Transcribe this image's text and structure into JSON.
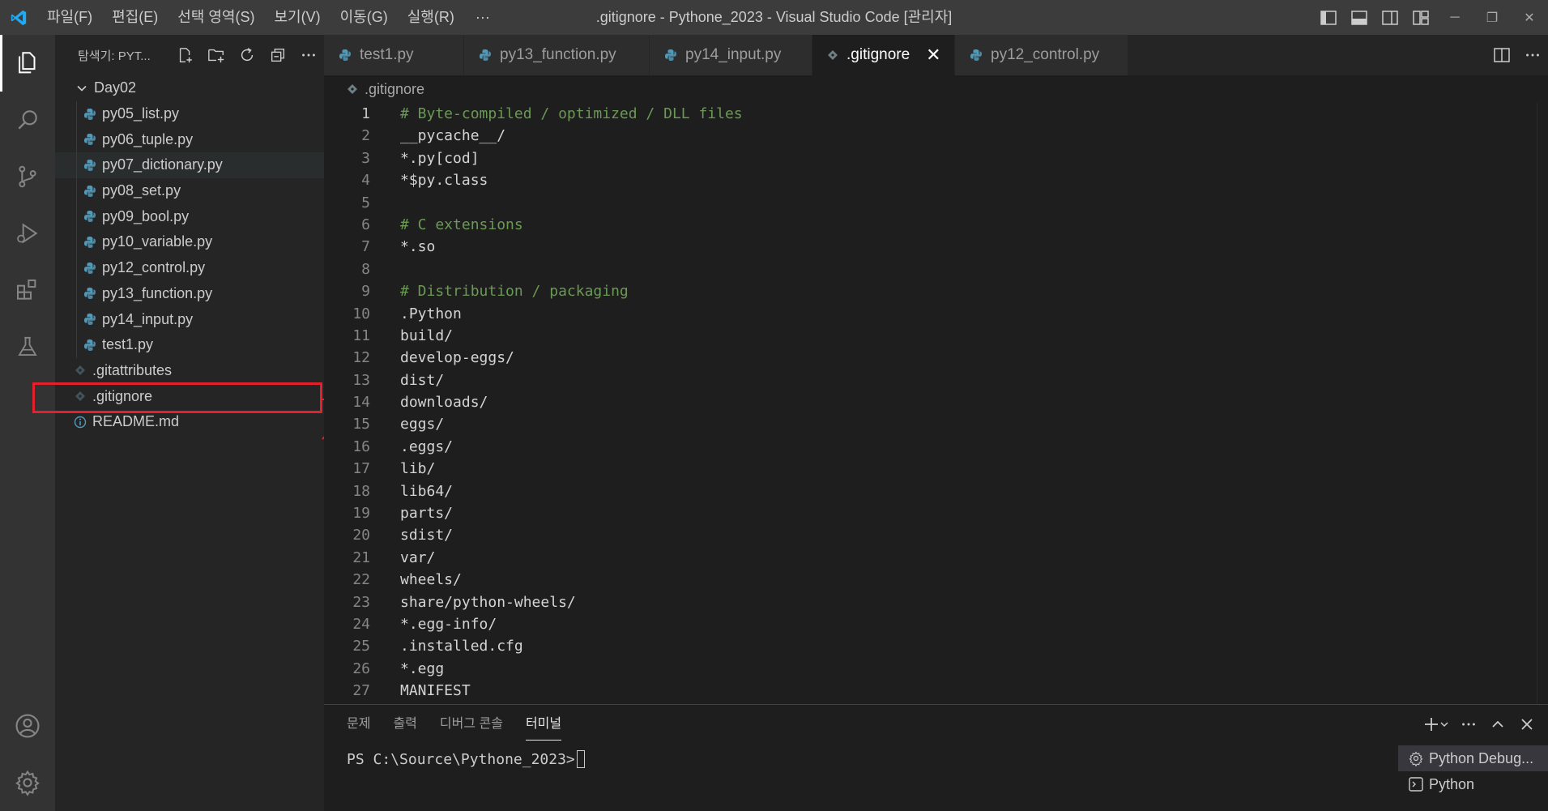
{
  "titlebar": {
    "menu": [
      "파일(F)",
      "편집(E)",
      "선택 영역(S)",
      "보기(V)",
      "이동(G)",
      "실행(R)"
    ],
    "more": "···",
    "title": ".gitignore - Pythone_2023 - Visual Studio Code [관리자]",
    "window_controls": [
      "─",
      "❐",
      "✕"
    ]
  },
  "sidebar": {
    "title": "탐색기: PYT...",
    "folder": "Day02",
    "files": [
      "py05_list.py",
      "py06_tuple.py",
      "py07_dictionary.py",
      "py08_set.py",
      "py09_bool.py",
      "py10_variable.py",
      "py12_control.py",
      "py13_function.py",
      "py14_input.py",
      "test1.py"
    ],
    "root_files": [
      ".gitattributes",
      ".gitignore",
      "README.md"
    ]
  },
  "tabs": [
    {
      "label": "test1.py",
      "active": false
    },
    {
      "label": "py13_function.py",
      "active": false
    },
    {
      "label": "py14_input.py",
      "active": false
    },
    {
      "label": ".gitignore",
      "active": true
    },
    {
      "label": "py12_control.py",
      "active": false
    }
  ],
  "tab_close": "✕",
  "breadcrumb": ".gitignore",
  "editor": {
    "lines": [
      {
        "n": "1",
        "text": "# Byte-compiled / optimized / DLL files"
      },
      {
        "n": "2",
        "text": "__pycache__/"
      },
      {
        "n": "3",
        "text": "*.py[cod]"
      },
      {
        "n": "4",
        "text": "*$py.class"
      },
      {
        "n": "5",
        "text": ""
      },
      {
        "n": "6",
        "text": "# C extensions"
      },
      {
        "n": "7",
        "text": "*.so"
      },
      {
        "n": "8",
        "text": ""
      },
      {
        "n": "9",
        "text": "# Distribution / packaging"
      },
      {
        "n": "10",
        "text": ".Python"
      },
      {
        "n": "11",
        "text": "build/"
      },
      {
        "n": "12",
        "text": "develop-eggs/"
      },
      {
        "n": "13",
        "text": "dist/"
      },
      {
        "n": "14",
        "text": "downloads/"
      },
      {
        "n": "15",
        "text": "eggs/"
      },
      {
        "n": "16",
        "text": ".eggs/"
      },
      {
        "n": "17",
        "text": "lib/"
      },
      {
        "n": "18",
        "text": "lib64/"
      },
      {
        "n": "19",
        "text": "parts/"
      },
      {
        "n": "20",
        "text": "sdist/"
      },
      {
        "n": "21",
        "text": "var/"
      },
      {
        "n": "22",
        "text": "wheels/"
      },
      {
        "n": "23",
        "text": "share/python-wheels/"
      },
      {
        "n": "24",
        "text": "*.egg-info/"
      },
      {
        "n": "25",
        "text": ".installed.cfg"
      },
      {
        "n": "26",
        "text": "*.egg"
      },
      {
        "n": "27",
        "text": "MANIFEST"
      }
    ]
  },
  "panel": {
    "tabs": [
      "문제",
      "출력",
      "디버그 콘솔",
      "터미널"
    ],
    "prompt": "PS C:\\Source\\Pythone_2023>",
    "terminals": [
      "Python Debug...",
      "Python"
    ]
  },
  "colors": {
    "accent": "#0078d4",
    "comment": "#6a9955",
    "python_icon": "#519aba",
    "highlight": "#e5202e"
  }
}
